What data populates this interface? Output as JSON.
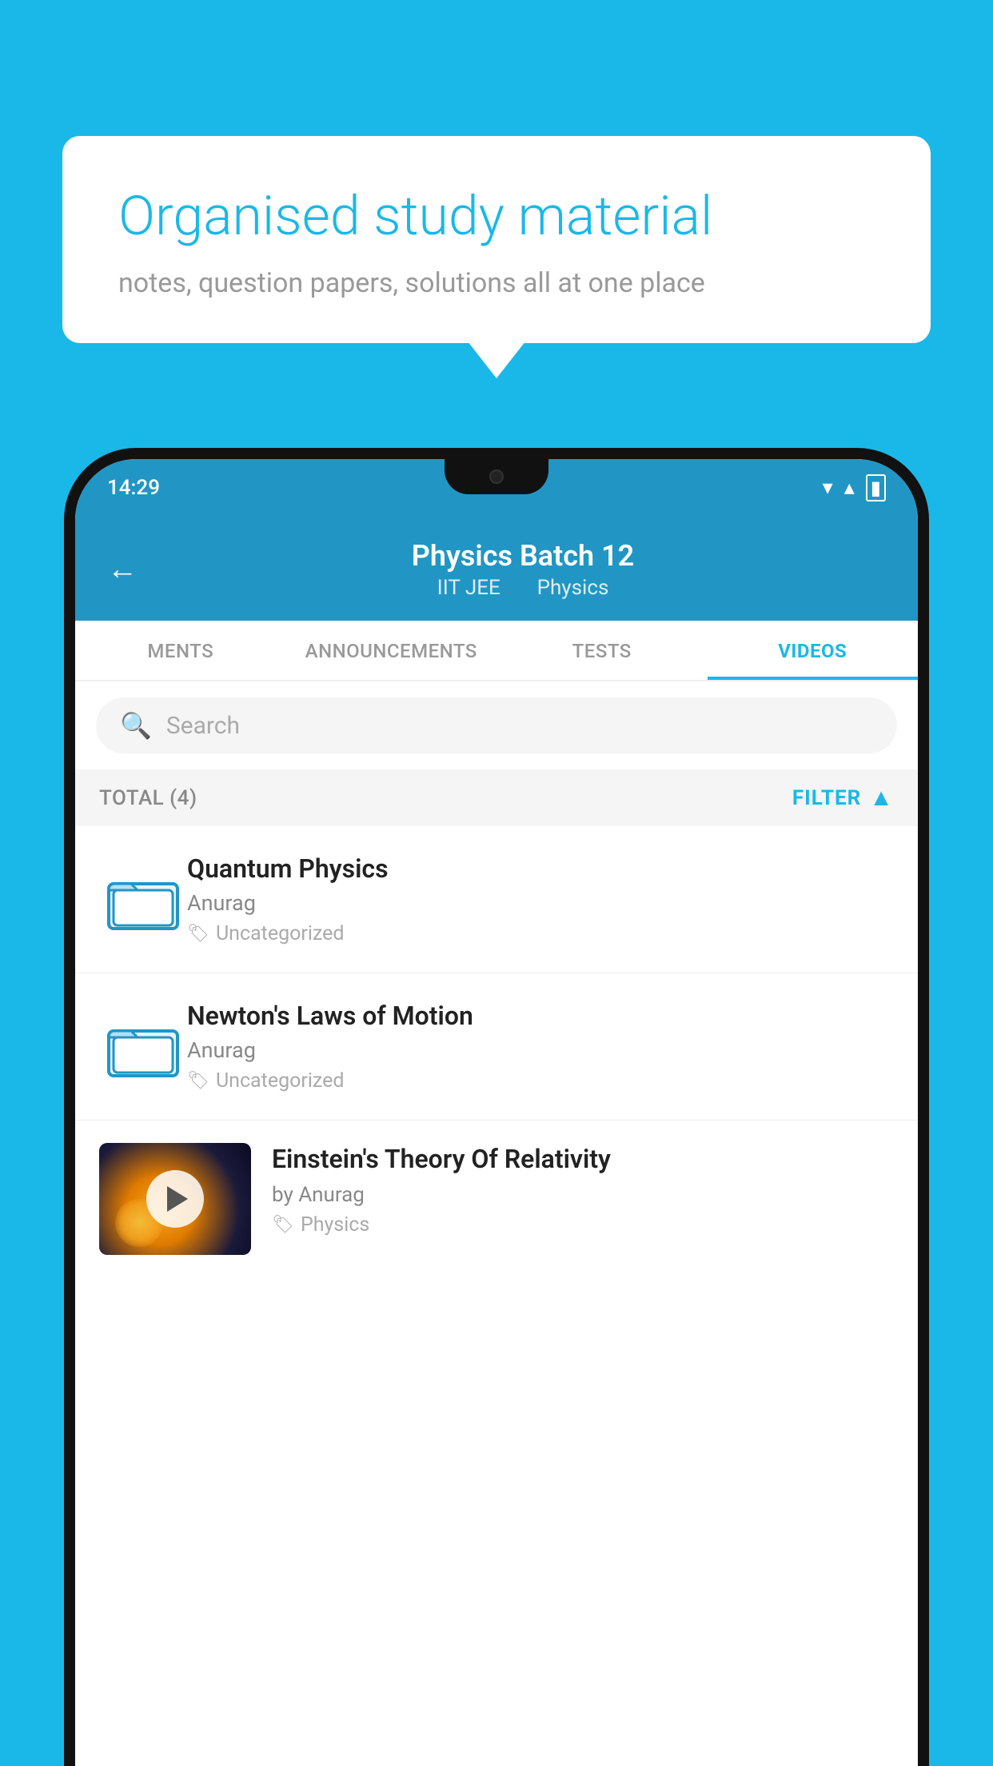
{
  "background_color": "#1ab8e8",
  "bubble": {
    "title": "Organised study material",
    "subtitle": "notes, question papers, solutions all at one place"
  },
  "phone": {
    "status_bar": {
      "time": "14:29",
      "wifi": "▾",
      "signal": "▴",
      "battery": "▮"
    },
    "app_bar": {
      "title": "Physics Batch 12",
      "subtitle1": "IIT JEE",
      "subtitle2": "Physics"
    },
    "tabs": [
      {
        "label": "MENTS",
        "active": false
      },
      {
        "label": "ANNOUNCEMENTS",
        "active": false
      },
      {
        "label": "TESTS",
        "active": false
      },
      {
        "label": "VIDEOS",
        "active": true
      }
    ],
    "search": {
      "placeholder": "Search"
    },
    "filter": {
      "total_label": "TOTAL (4)",
      "filter_label": "FILTER"
    },
    "videos": [
      {
        "title": "Quantum Physics",
        "author": "Anurag",
        "tag": "Uncategorized",
        "type": "folder"
      },
      {
        "title": "Newton's Laws of Motion",
        "author": "Anurag",
        "tag": "Uncategorized",
        "type": "folder"
      },
      {
        "title": "Einstein's Theory Of Relativity",
        "author": "by Anurag",
        "tag": "Physics",
        "type": "video"
      }
    ]
  }
}
